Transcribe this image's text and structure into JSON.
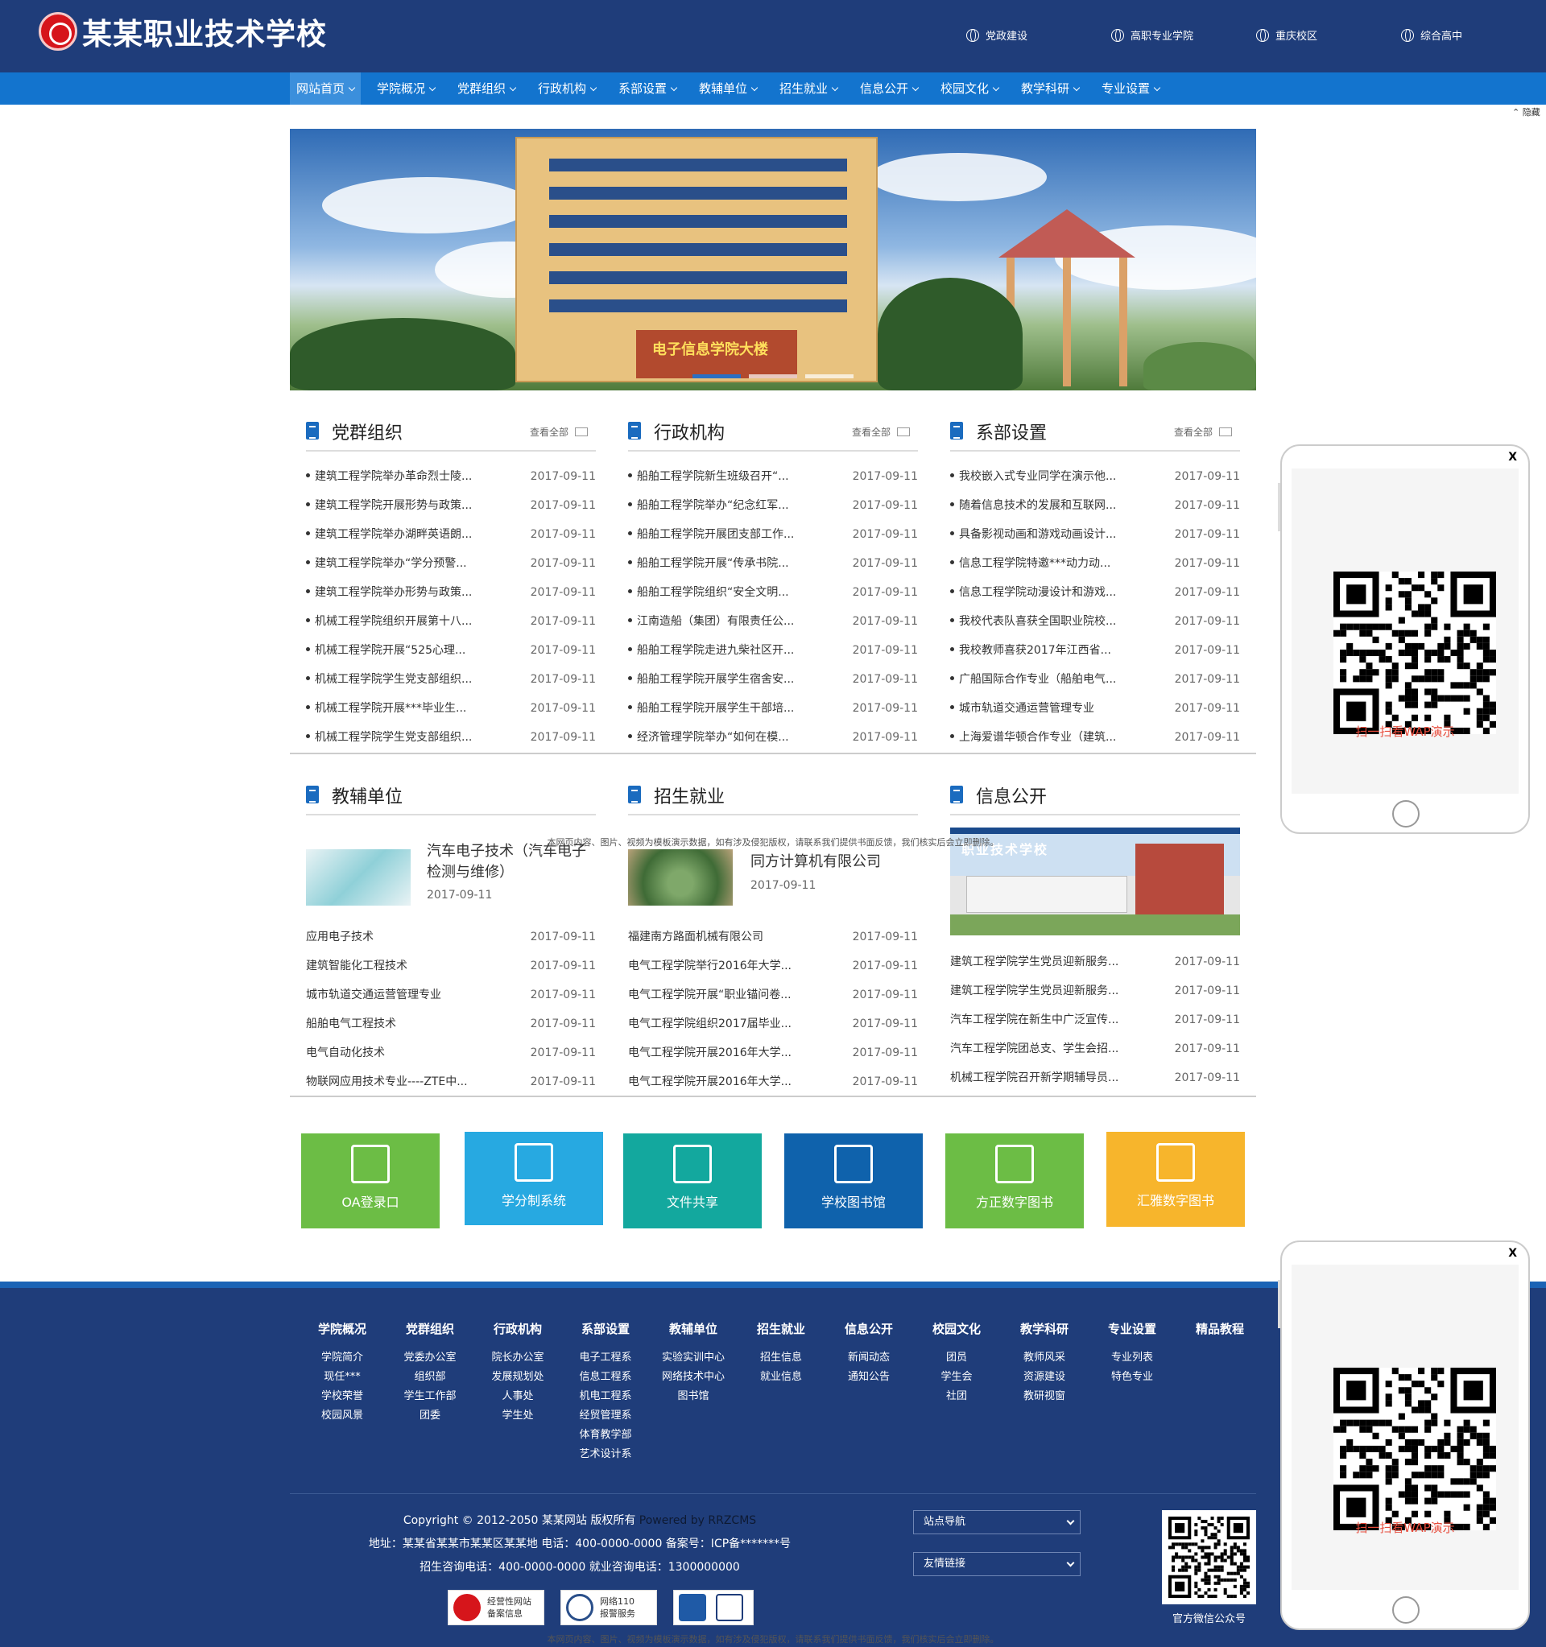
{
  "header": {
    "logo_text": "某某职业技术学校",
    "links": [
      "党政建设",
      "高职专业学院",
      "重庆校区",
      "综合高中"
    ]
  },
  "nav": {
    "items": [
      "网站首页",
      "学院概况",
      "党群组织",
      "行政机构",
      "系部设置",
      "教辅单位",
      "招生就业",
      "信息公开",
      "校园文化",
      "教学科研",
      "专业设置"
    ],
    "hide_label": "隐藏"
  },
  "banner": {
    "gate_text": "电子信息学院大楼"
  },
  "sections_top": [
    {
      "title": "党群组织",
      "more": "查看全部",
      "items": [
        {
          "title": "建筑工程学院举办革命烈士陵...",
          "date": "2017-09-11"
        },
        {
          "title": "建筑工程学院开展形势与政策...",
          "date": "2017-09-11"
        },
        {
          "title": "建筑工程学院举办湖畔英语朗...",
          "date": "2017-09-11"
        },
        {
          "title": "建筑工程学院举办“学分预警...",
          "date": "2017-09-11"
        },
        {
          "title": "建筑工程学院举办形势与政策...",
          "date": "2017-09-11"
        },
        {
          "title": "机械工程学院组织开展第十八...",
          "date": "2017-09-11"
        },
        {
          "title": "机械工程学院开展“525心理...",
          "date": "2017-09-11"
        },
        {
          "title": "机械工程学院学生党支部组织...",
          "date": "2017-09-11"
        },
        {
          "title": "机械工程学院开展***毕业生...",
          "date": "2017-09-11"
        },
        {
          "title": "机械工程学院学生党支部组织...",
          "date": "2017-09-11"
        }
      ]
    },
    {
      "title": "行政机构",
      "more": "查看全部",
      "items": [
        {
          "title": "船舶工程学院新生班级召开“...",
          "date": "2017-09-11"
        },
        {
          "title": "船舶工程学院举办“纪念红军...",
          "date": "2017-09-11"
        },
        {
          "title": "船舶工程学院开展团支部工作...",
          "date": "2017-09-11"
        },
        {
          "title": "船舶工程学院开展“传承书院...",
          "date": "2017-09-11"
        },
        {
          "title": "船舶工程学院组织“安全文明...",
          "date": "2017-09-11"
        },
        {
          "title": "江南造船（集团）有限责任公...",
          "date": "2017-09-11"
        },
        {
          "title": "船舶工程学院走进九柴社区开...",
          "date": "2017-09-11"
        },
        {
          "title": "船舶工程学院开展学生宿舍安...",
          "date": "2017-09-11"
        },
        {
          "title": "船舶工程学院开展学生干部培...",
          "date": "2017-09-11"
        },
        {
          "title": "经济管理学院举办“如何在模...",
          "date": "2017-09-11"
        }
      ]
    },
    {
      "title": "系部设置",
      "more": "查看全部",
      "items": [
        {
          "title": "我校嵌入式专业同学在演示他...",
          "date": "2017-09-11"
        },
        {
          "title": "随着信息技术的发展和互联网...",
          "date": "2017-09-11"
        },
        {
          "title": "具备影视动画和游戏动画设计...",
          "date": "2017-09-11"
        },
        {
          "title": "信息工程学院特邀***动力动...",
          "date": "2017-09-11"
        },
        {
          "title": "信息工程学院动漫设计和游戏...",
          "date": "2017-09-11"
        },
        {
          "title": "我校代表队喜获全国职业院校...",
          "date": "2017-09-11"
        },
        {
          "title": "我校教师喜获2017年江西省...",
          "date": "2017-09-11"
        },
        {
          "title": "广船国际合作专业（船舶电气...",
          "date": "2017-09-11"
        },
        {
          "title": "城市轨道交通运营管理专业",
          "date": "2017-09-11"
        },
        {
          "title": "上海爱谱华顿合作专业（建筑...",
          "date": "2017-09-11"
        }
      ]
    }
  ],
  "sections_bottom": [
    {
      "title": "教辅单位",
      "feature": {
        "title": "汽车电子技术（汽车电子检测与维修）",
        "date": "2017-09-11"
      },
      "items": [
        {
          "title": "应用电子技术",
          "date": "2017-09-11"
        },
        {
          "title": "建筑智能化工程技术",
          "date": "2017-09-11"
        },
        {
          "title": "城市轨道交通运营管理专业",
          "date": "2017-09-11"
        },
        {
          "title": "船舶电气工程技术",
          "date": "2017-09-11"
        },
        {
          "title": "电气自动化技术",
          "date": "2017-09-11"
        },
        {
          "title": "物联网应用技术专业----ZTE中...",
          "date": "2017-09-11"
        }
      ]
    },
    {
      "title": "招生就业",
      "feature": {
        "title": "同方计算机有限公司",
        "date": "2017-09-11"
      },
      "items": [
        {
          "title": "福建南方路面机械有限公司",
          "date": "2017-09-11"
        },
        {
          "title": "电气工程学院举行2016年大学...",
          "date": "2017-09-11"
        },
        {
          "title": "电气工程学院开展“职业锚问卷...",
          "date": "2017-09-11"
        },
        {
          "title": "电气工程学院组织2017届毕业...",
          "date": "2017-09-11"
        },
        {
          "title": "电气工程学院开展2016年大学...",
          "date": "2017-09-11"
        },
        {
          "title": "电气工程学院开展2016年大学...",
          "date": "2017-09-11"
        }
      ]
    },
    {
      "title": "信息公开",
      "feature": {
        "caption": "职业技术学校"
      },
      "items": [
        {
          "title": "建筑工程学院学生党员迎新服务...",
          "date": "2017-09-11"
        },
        {
          "title": "建筑工程学院学生党员迎新服务...",
          "date": "2017-09-11"
        },
        {
          "title": "汽车工程学院在新生中广泛宣传...",
          "date": "2017-09-11"
        },
        {
          "title": "汽车工程学院团总支、学生会招...",
          "date": "2017-09-11"
        },
        {
          "title": "机械工程学院召开新学期辅导员...",
          "date": "2017-09-11"
        }
      ]
    }
  ],
  "tiles": [
    {
      "label": "OA登录口",
      "color": "#6cbd45",
      "icon": "oa-icon"
    },
    {
      "label": "学分制系统",
      "color": "#27a9e1",
      "icon": "monitor-chart-icon"
    },
    {
      "label": "文件共享",
      "color": "#13a89e",
      "icon": "document-share-icon"
    },
    {
      "label": "学校图书馆",
      "color": "#0f62ac",
      "icon": "bookshelf-icon"
    },
    {
      "label": "方正数字图书",
      "color": "#6cbd45",
      "icon": "book-icon"
    },
    {
      "label": "汇雅数字图书",
      "color": "#f7b52c",
      "icon": "books-icon"
    }
  ],
  "footer": {
    "columns": [
      {
        "heading": "学院概况",
        "links": [
          "学院简介",
          "现任***",
          "学校荣誉",
          "校园风景"
        ]
      },
      {
        "heading": "党群组织",
        "links": [
          "党委办公室",
          "组织部",
          "学生工作部",
          "团委"
        ]
      },
      {
        "heading": "行政机构",
        "links": [
          "院长办公室",
          "发展规划处",
          "人事处",
          "学生处"
        ]
      },
      {
        "heading": "系部设置",
        "links": [
          "电子工程系",
          "信息工程系",
          "机电工程系",
          "经贸管理系",
          "体育教学部",
          "艺术设计系"
        ]
      },
      {
        "heading": "教辅单位",
        "links": [
          "实验实训中心",
          "网络技术中心",
          "图书馆"
        ]
      },
      {
        "heading": "招生就业",
        "links": [
          "招生信息",
          "就业信息"
        ]
      },
      {
        "heading": "信息公开",
        "links": [
          "新闻动态",
          "通知公告"
        ]
      },
      {
        "heading": "校园文化",
        "links": [
          "团员",
          "学生会",
          "社团"
        ]
      },
      {
        "heading": "教学科研",
        "links": [
          "教师风采",
          "资源建设",
          "教研视窗"
        ]
      },
      {
        "heading": "专业设置",
        "links": [
          "专业列表",
          "特色专业"
        ]
      },
      {
        "heading": "精品教程",
        "links": []
      }
    ],
    "copyright": "Copyright © 2012-2050 某某网站 版权所有",
    "powered": "Powered by RRZCMS",
    "address": "地址：某某省某某市某某区某某地 电话：400-0000-0000 备案号：ICP备*******号",
    "hotline": "招生咨询电话：400-0000-0000 就业咨询电话：1300000000",
    "select_site_nav": "站点导航",
    "select_friend_links": "友情链接",
    "badges": [
      {
        "line1": "经营性网站",
        "line2": "备案信息"
      },
      {
        "line1": "网络110",
        "line2": "报警服务"
      },
      {
        "line1": "",
        "line2": ""
      }
    ],
    "wechat_caption": "官方微信公众号"
  },
  "disclaimer": "本网页内容、图片、视频为模板演示数据，如有涉及侵犯版权，请联系我们提供书面反馈，我们核实后会立即删除。",
  "phone_popup": {
    "close": "X",
    "caption": "扫一扫看WAP演示"
  }
}
